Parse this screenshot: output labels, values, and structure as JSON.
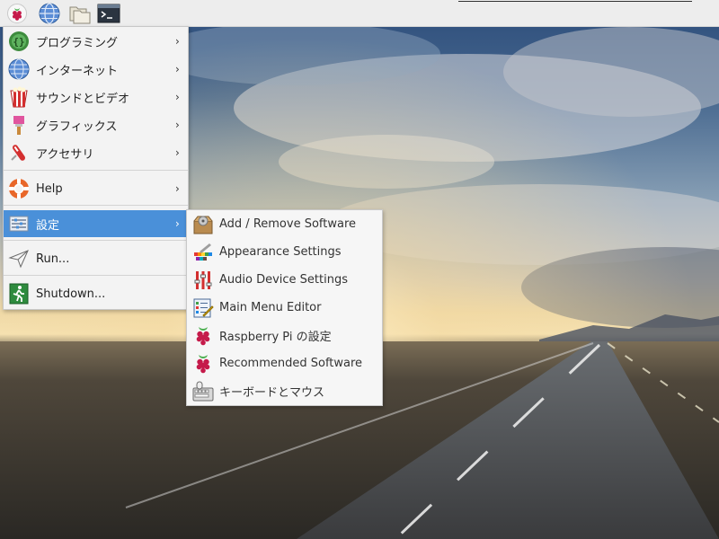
{
  "panel": {
    "launchers": [
      "raspberry-icon",
      "globe-icon",
      "folder-icon",
      "terminal-icon"
    ]
  },
  "main_menu": {
    "items": [
      {
        "label": "プログラミング",
        "icon": "programming-icon",
        "has_submenu": true
      },
      {
        "label": "インターネット",
        "icon": "internet-icon",
        "has_submenu": true
      },
      {
        "label": "サウンドとビデオ",
        "icon": "sound-video-icon",
        "has_submenu": true
      },
      {
        "label": "グラフィックス",
        "icon": "graphics-icon",
        "has_submenu": true
      },
      {
        "label": "アクセサリ",
        "icon": "accessories-icon",
        "has_submenu": true
      },
      {
        "label": "Help",
        "icon": "help-icon",
        "has_submenu": true
      },
      {
        "label": "設定",
        "icon": "settings-icon",
        "has_submenu": true,
        "selected": true
      },
      {
        "label": "Run...",
        "icon": "run-icon",
        "has_submenu": false
      },
      {
        "label": "Shutdown...",
        "icon": "shutdown-icon",
        "has_submenu": false
      }
    ]
  },
  "settings_submenu": {
    "items": [
      {
        "label": "Add / Remove Software",
        "icon": "package-icon"
      },
      {
        "label": "Appearance Settings",
        "icon": "appearance-icon"
      },
      {
        "label": "Audio Device Settings",
        "icon": "audio-mixer-icon"
      },
      {
        "label": "Main Menu Editor",
        "icon": "menu-editor-icon"
      },
      {
        "label": "Raspberry Pi の設定",
        "icon": "raspberry-icon"
      },
      {
        "label": "Recommended Software",
        "icon": "raspberry-icon"
      },
      {
        "label": "キーボードとマウス",
        "icon": "keyboard-mouse-icon"
      }
    ]
  },
  "colors": {
    "selection": "#4a90d9",
    "panel": "#ededed",
    "menu_bg": "#f3f3f3"
  }
}
